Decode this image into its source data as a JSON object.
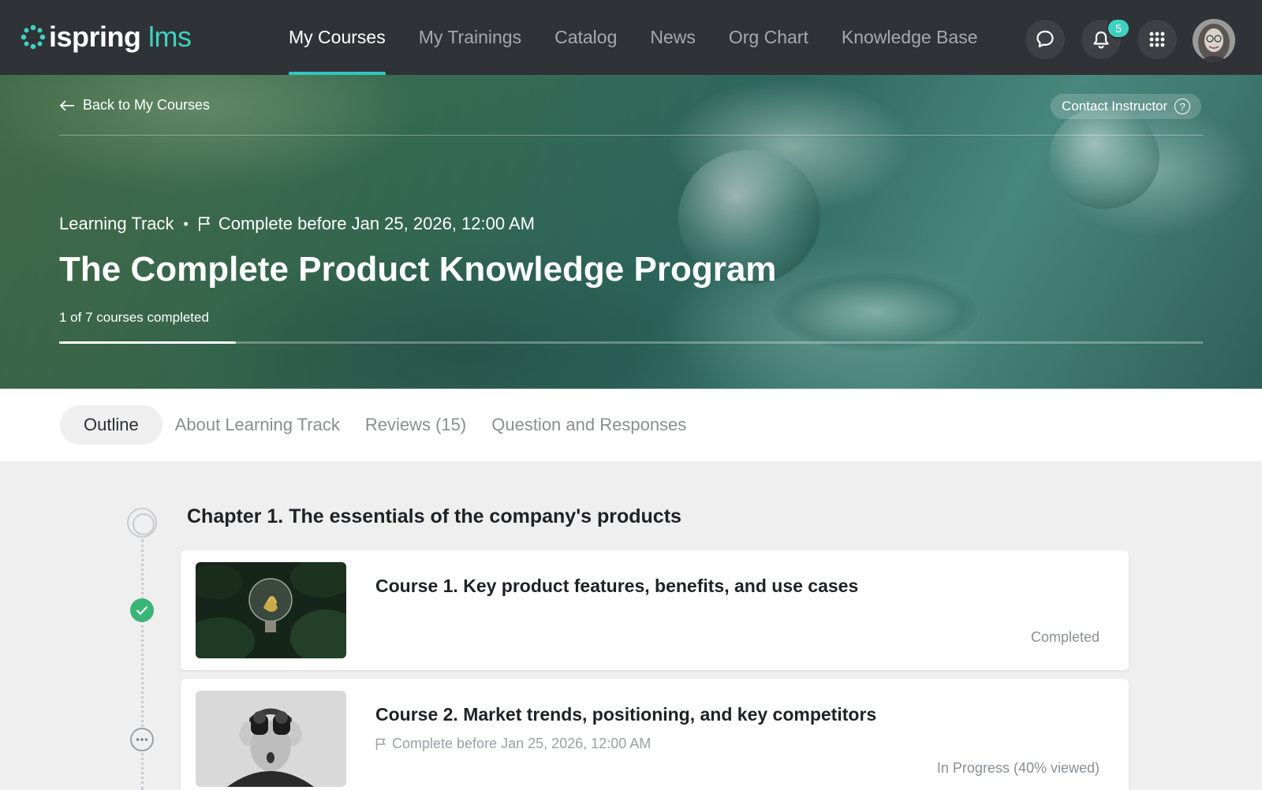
{
  "brand": {
    "name": "ispring",
    "suffix": "lms",
    "accent": "#3fd0c0"
  },
  "nav": {
    "items": [
      {
        "label": "My Courses",
        "active": true
      },
      {
        "label": "My Trainings"
      },
      {
        "label": "Catalog"
      },
      {
        "label": "News"
      },
      {
        "label": "Org Chart"
      },
      {
        "label": "Knowledge Base"
      }
    ],
    "notifications_count": "5",
    "icons": [
      "chat-icon",
      "bell-icon",
      "apps-grid-icon"
    ]
  },
  "hero": {
    "back_label": "Back to My Courses",
    "contact_label": "Contact Instructor",
    "contact_help": "?",
    "type_label": "Learning Track",
    "separator": "•",
    "deadline": "Complete before Jan 25, 2026, 12:00 AM",
    "title": "The Complete Product Knowledge Program",
    "progress_text": "1 of 7 courses completed",
    "progress_fraction": 0.1547
  },
  "tabs": [
    {
      "label": "Outline",
      "active": true
    },
    {
      "label": "About Learning Track"
    },
    {
      "label": "Reviews (15)"
    },
    {
      "label": "Question and Responses"
    }
  ],
  "outline": {
    "chapter_title": "Chapter 1. The essentials of the company's products",
    "courses": [
      {
        "title": "Course 1. Key product features, benefits, and use cases",
        "status": "Completed",
        "status_color": "#3bb577"
      },
      {
        "title": "Course 2. Market trends, positioning, and key competitors",
        "deadline": "Complete before Jan 25, 2026, 12:00 AM",
        "status": "In Progress (40% viewed)"
      }
    ]
  }
}
